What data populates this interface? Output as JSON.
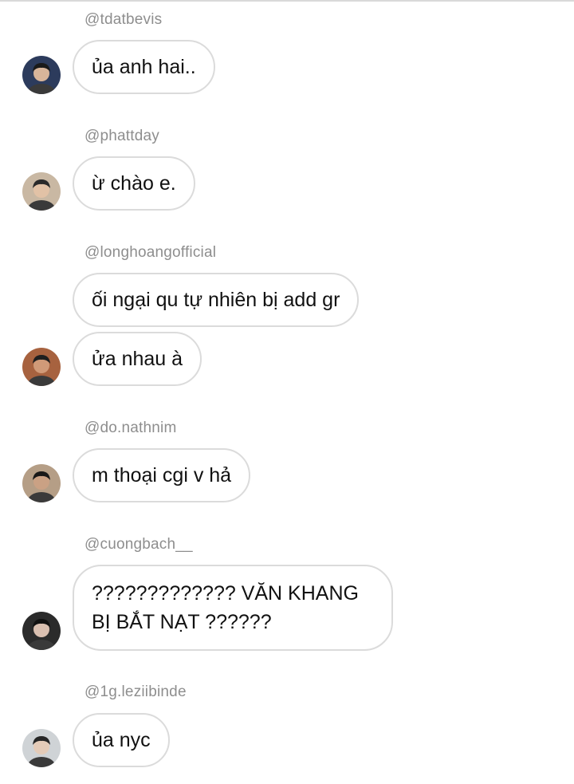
{
  "messages": [
    {
      "username": "@tdatbevis",
      "bubbles": [
        "ủa anh hai.."
      ],
      "avatar": {
        "icon": "user-avatar-icon",
        "bg": "#2c3b5c",
        "skin": "#d8b59a",
        "hair": "#1a1a1a"
      }
    },
    {
      "username": "@phattday",
      "bubbles": [
        "ừ chào e."
      ],
      "avatar": {
        "icon": "user-avatar-icon",
        "bg": "#c9b8a3",
        "skin": "#e2c2a6",
        "hair": "#2a2a2a"
      }
    },
    {
      "username": "@longhoangofficial",
      "bubbles": [
        "ối ngại qu tự nhiên bị add gr",
        "ửa nhau à"
      ],
      "avatar": {
        "icon": "user-avatar-icon",
        "bg": "#a7623f",
        "skin": "#d09a78",
        "hair": "#1f1f1f"
      }
    },
    {
      "username": "@do.nathnim",
      "bubbles": [
        "m thoại cgi v hả"
      ],
      "avatar": {
        "icon": "user-avatar-icon",
        "bg": "#b59e86",
        "skin": "#caa184",
        "hair": "#181818"
      }
    },
    {
      "username": "@cuongbach__",
      "bubbles": [
        "????????????? VĂN KHANG BỊ BẮT NẠT ??????"
      ],
      "avatar": {
        "icon": "user-avatar-icon",
        "bg": "#2b2b2b",
        "skin": "#d9bfb0",
        "hair": "#111111"
      }
    },
    {
      "username": "@1g.leziibinde",
      "bubbles": [
        "ủa nyc"
      ],
      "avatar": {
        "icon": "user-avatar-icon",
        "bg": "#cfd3d6",
        "skin": "#e4cbb8",
        "hair": "#262626"
      }
    }
  ]
}
